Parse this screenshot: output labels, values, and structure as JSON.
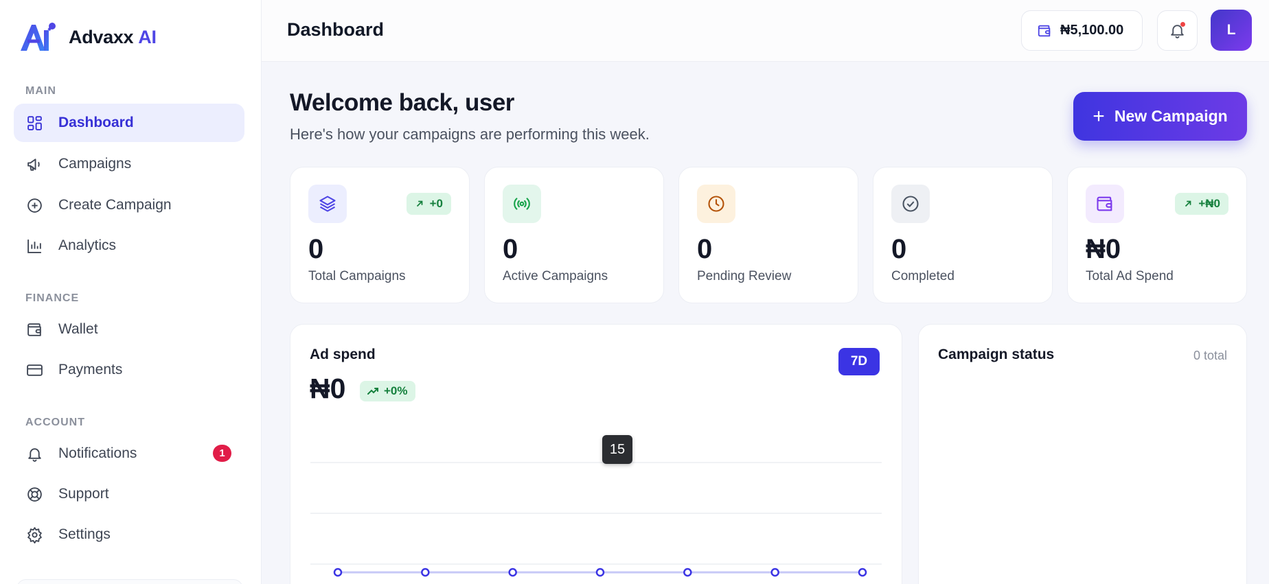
{
  "brand": {
    "name": "Advaxx",
    "suffix": "AI"
  },
  "sidebar": {
    "sections": [
      {
        "title": "MAIN"
      },
      {
        "title": "FINANCE"
      },
      {
        "title": "ACCOUNT"
      }
    ],
    "items": [
      {
        "label": "Dashboard",
        "icon": "grid-icon",
        "active": true
      },
      {
        "label": "Campaigns",
        "icon": "megaphone-icon"
      },
      {
        "label": "Create Campaign",
        "icon": "plus-circle-icon"
      },
      {
        "label": "Analytics",
        "icon": "bar-chart-icon"
      },
      {
        "label": "Wallet",
        "icon": "wallet-icon"
      },
      {
        "label": "Payments",
        "icon": "credit-card-icon"
      },
      {
        "label": "Notifications",
        "icon": "bell-icon",
        "badge": "1"
      },
      {
        "label": "Support",
        "icon": "lifebuoy-icon"
      },
      {
        "label": "Settings",
        "icon": "gear-icon"
      }
    ]
  },
  "header": {
    "title": "Dashboard",
    "wallet_balance": "₦5,100.00",
    "avatar_initial": "L"
  },
  "main": {
    "welcome": "Welcome back, user",
    "subtitle": "Here's how your campaigns are performing this week.",
    "new_campaign_label": "New Campaign",
    "stats": [
      {
        "value": "0",
        "label": "Total Campaigns",
        "trend": "+0",
        "icon": "layers-icon",
        "tint": "#eceefe",
        "color": "#4f46e5"
      },
      {
        "value": "0",
        "label": "Active Campaigns",
        "icon": "broadcast-icon",
        "tint": "#e3f6ec",
        "color": "#16a34a"
      },
      {
        "value": "0",
        "label": "Pending Review",
        "icon": "clock-icon",
        "tint": "#fdf1de",
        "color": "#b45309"
      },
      {
        "value": "0",
        "label": "Completed",
        "icon": "check-circle-icon",
        "tint": "#eef0f4",
        "color": "#4b5563"
      },
      {
        "value": "₦0",
        "label": "Total Ad Spend",
        "trend": "+₦0",
        "icon": "wallet-icon",
        "tint": "#f3ebfe",
        "color": "#7c3aed"
      }
    ],
    "ad_spend": {
      "title": "Ad spend",
      "value": "₦0",
      "trend": "+0%",
      "range": "7D",
      "tooltip": "15"
    },
    "campaign_status": {
      "title": "Campaign status",
      "total": "0 total"
    }
  },
  "colors": {
    "accent": "#4f46e5",
    "success": "#15803d",
    "danger": "#e11d48"
  },
  "chart_data": {
    "type": "line",
    "series": [
      {
        "values": [
          0,
          0,
          0,
          0,
          0,
          0,
          0
        ]
      }
    ],
    "grid": true
  }
}
